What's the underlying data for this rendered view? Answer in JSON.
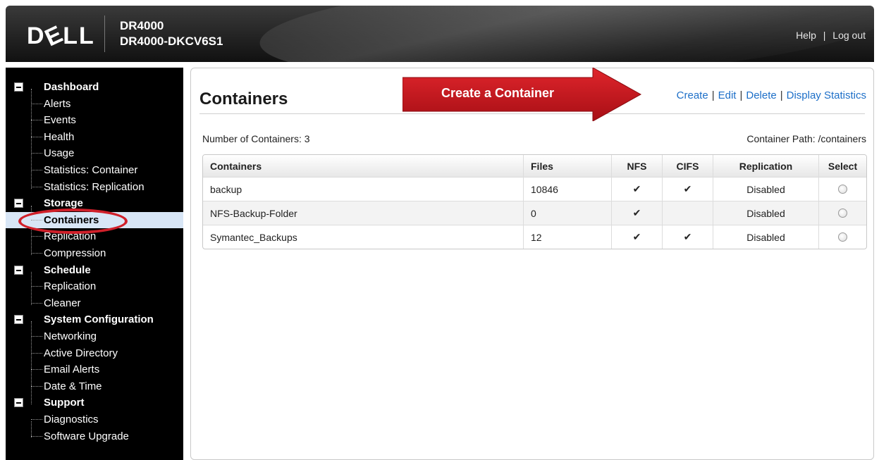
{
  "header": {
    "logo": "DELL",
    "product": "DR4000",
    "hostname": "DR4000-DKCV6S1",
    "links": {
      "help": "Help",
      "separator": "|",
      "logout": "Log out"
    }
  },
  "sidebar": {
    "items": [
      {
        "label": "Dashboard",
        "section": true
      },
      {
        "label": "Alerts"
      },
      {
        "label": "Events"
      },
      {
        "label": "Health"
      },
      {
        "label": "Usage"
      },
      {
        "label": "Statistics: Container"
      },
      {
        "label": "Statistics: Replication"
      },
      {
        "label": "Storage",
        "section": true
      },
      {
        "label": "Containers",
        "selected": true
      },
      {
        "label": "Replication"
      },
      {
        "label": "Compression"
      },
      {
        "label": "Schedule",
        "section": true
      },
      {
        "label": "Replication"
      },
      {
        "label": "Cleaner"
      },
      {
        "label": "System Configuration",
        "section": true
      },
      {
        "label": "Networking"
      },
      {
        "label": "Active Directory"
      },
      {
        "label": "Email Alerts"
      },
      {
        "label": "Date & Time"
      },
      {
        "label": "Support",
        "section": true
      },
      {
        "label": "Diagnostics"
      },
      {
        "label": "Software Upgrade"
      }
    ]
  },
  "main": {
    "title": "Containers",
    "actions": [
      "Create",
      "Edit",
      "Delete",
      "Display Statistics"
    ],
    "action_separator": "|",
    "count_text": "Number of Containers: 3",
    "path_text": "Container Path: /containers",
    "annotation": "Create a Container"
  },
  "table": {
    "headers": [
      "Containers",
      "Files",
      "NFS",
      "CIFS",
      "Replication",
      "Select"
    ],
    "rows": [
      {
        "name": "backup",
        "files": "10846",
        "nfs": "✔",
        "cifs": "✔",
        "replication": "Disabled"
      },
      {
        "name": "NFS-Backup-Folder",
        "files": "0",
        "nfs": "✔",
        "cifs": "",
        "replication": "Disabled"
      },
      {
        "name": "Symantec_Backups",
        "files": "12",
        "nfs": "✔",
        "cifs": "✔",
        "replication": "Disabled"
      }
    ]
  },
  "colors": {
    "accent_link": "#1d6fc8",
    "annotation_red": "#c8161d",
    "selected_bg": "#d8e6f6"
  }
}
